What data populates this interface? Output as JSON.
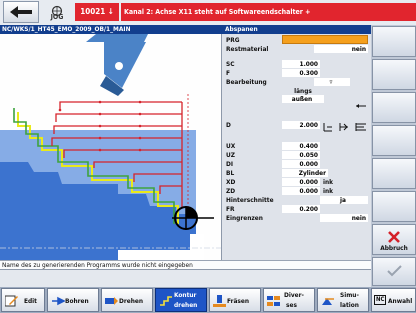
{
  "top": {
    "alarm_number": "10021",
    "message": "Kanal 2: Achse X11 steht auf Softwareendschalter +",
    "jog_label": "JOG"
  },
  "path": "NC/WKS/1_HT45_EMO_2009_OB/1_MAIN",
  "form": {
    "title": "Abspanen",
    "prg_label": "PRG",
    "prg_value": "",
    "rest_label": "Restmaterial",
    "rest_value": "nein",
    "sc_label": "SC",
    "sc_value": "1.000",
    "f_label": "F",
    "f_value": "0.300",
    "bearb_label": "Bearbeitung",
    "bearb_value": "▿",
    "laengs": "längs",
    "aussen": "außen",
    "d_label": "D",
    "d_value": "2.000",
    "ux_label": "UX",
    "ux_value": "0.400",
    "uz_label": "UZ",
    "uz_value": "0.050",
    "di_label": "DI",
    "di_value": "0.000",
    "bl_label": "BL",
    "bl_value": "Zylinder",
    "xd_label": "XD",
    "xd_value": "0.000",
    "xd_unit": "ink",
    "zd_label": "ZD",
    "zd_value": "0.000",
    "zd_unit": "ink",
    "hinter_label": "Hinterschnitte",
    "hinter_value": "ja",
    "fr_label": "FR",
    "fr_value": "0.200",
    "eingr_label": "Eingrenzen",
    "eingr_value": "nein"
  },
  "message_line": "Name des zu generierenden Programms wurde nicht eingegeben",
  "vertical_softkeys": {
    "abbruch": "Abbruch"
  },
  "horizontal_softkeys": {
    "edit": "Edit",
    "bohren": "Bohren",
    "drehen": "Drehen",
    "kontur_1": "Kontur",
    "kontur_2": "drehen",
    "fraesen": "Fräsen",
    "divers_1": "Diver-",
    "divers_2": "ses",
    "simu_1": "Simu-",
    "simu_2": "lation",
    "anwahl": "Anwahl",
    "nc_badge": "NC"
  },
  "colors": {
    "alarm_red": "#e1252e",
    "header_blue": "#123e8e",
    "prg_orange": "#f5a01d",
    "active_softkey": "#1e55c6"
  }
}
